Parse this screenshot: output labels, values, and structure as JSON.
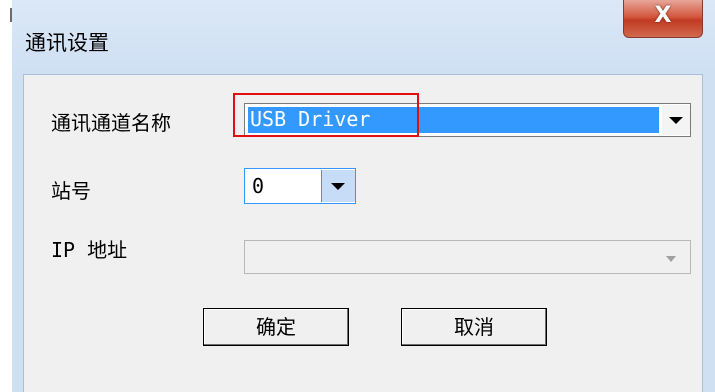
{
  "window": {
    "title": "通讯设置",
    "close_label": "X"
  },
  "form": {
    "channel": {
      "label": "通讯通道名称",
      "value": "USB Driver"
    },
    "station": {
      "label": "站号",
      "value": "0"
    },
    "ip": {
      "label": "IP 地址",
      "value": ""
    }
  },
  "buttons": {
    "ok_label": "确定",
    "cancel_label": "取消"
  },
  "colors": {
    "selection": "#3399ff",
    "highlight_box": "#e01010",
    "close_red": "#c23a22"
  }
}
